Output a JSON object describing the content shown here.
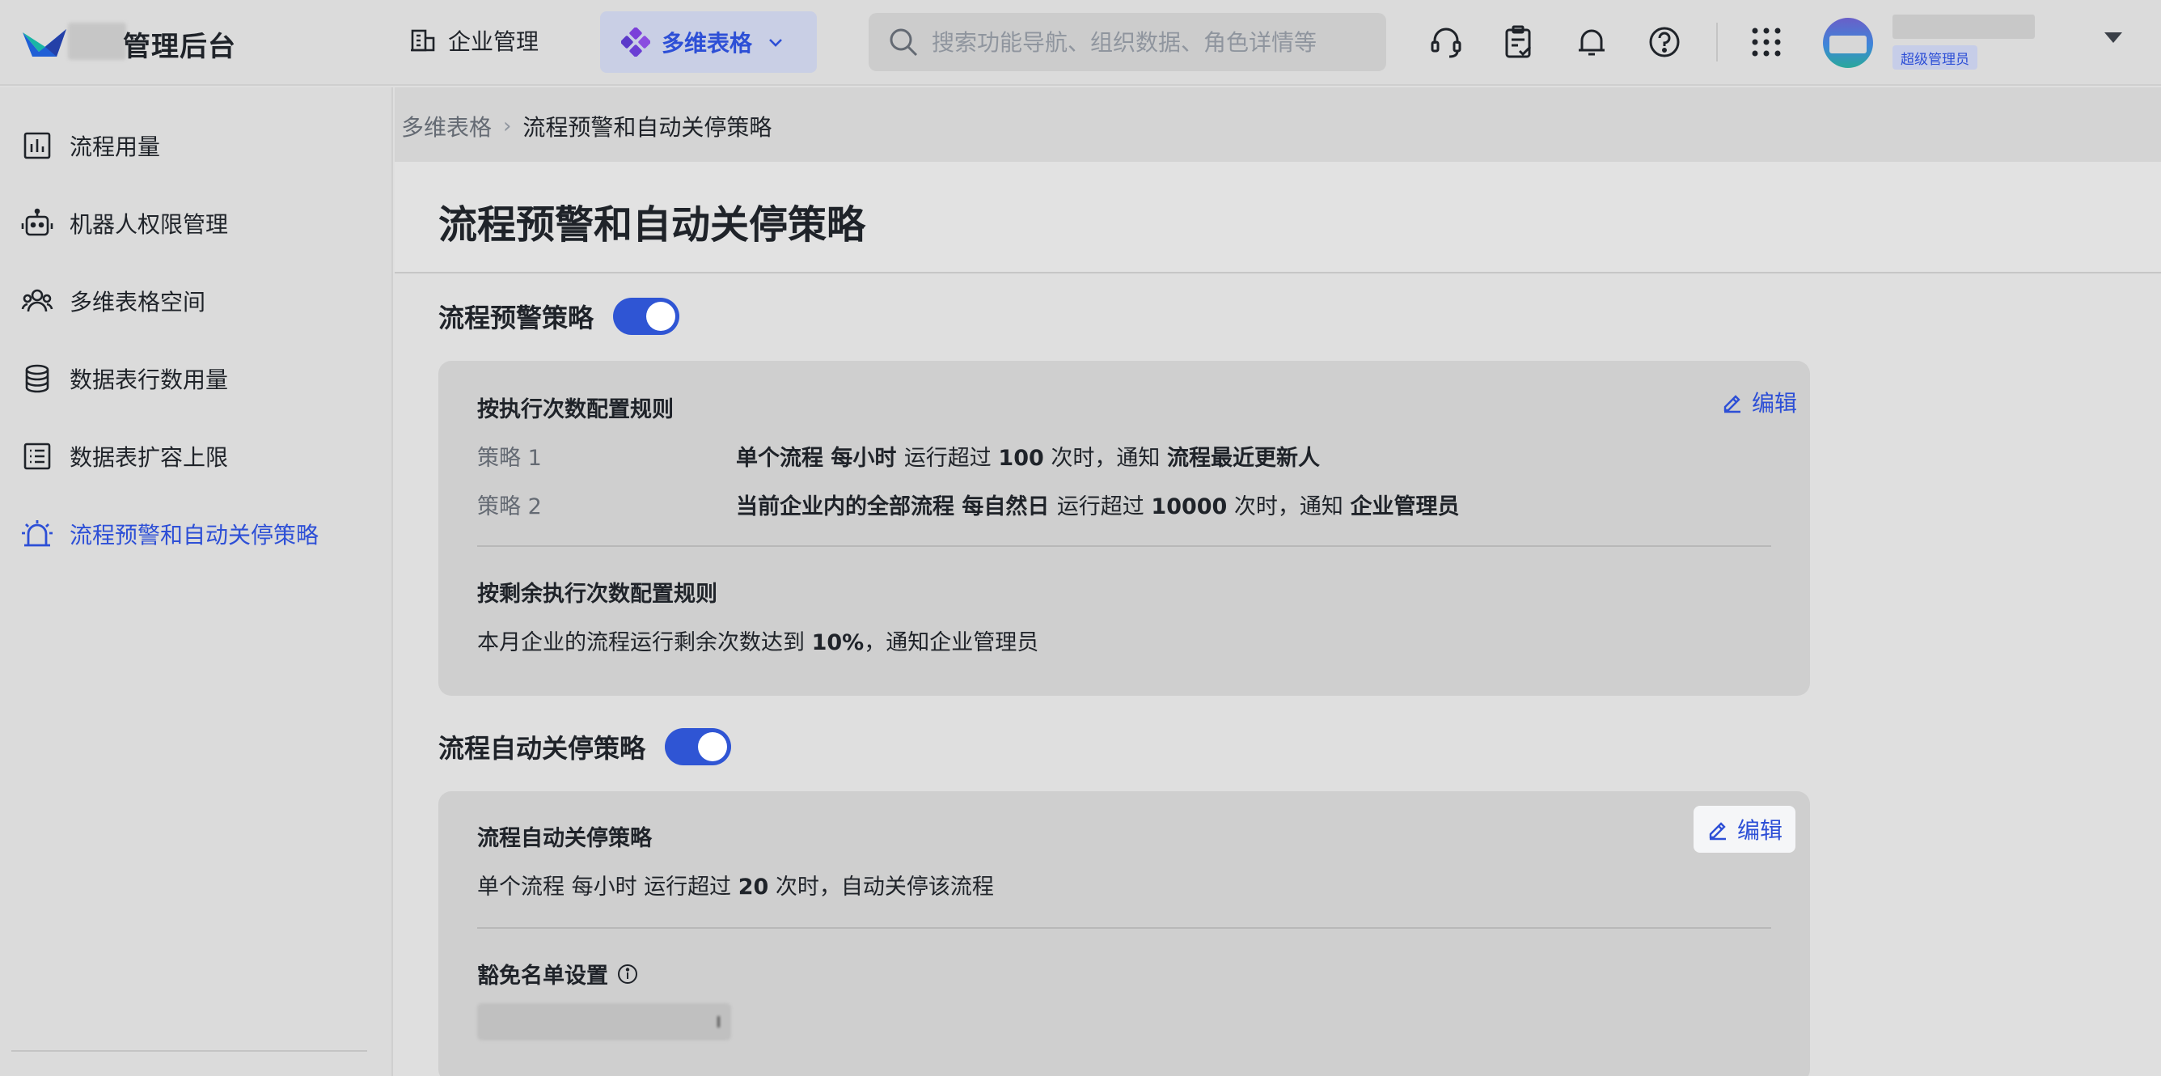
{
  "header": {
    "logo_text": "管理后台",
    "nav_org_label": "企业管理",
    "nav_bitable_label": "多维表格",
    "search_placeholder": "搜索功能导航、组织数据、角色详情等",
    "user_badge": "超级管理员",
    "icons": [
      "headset-icon",
      "clipboard-check-icon",
      "bell-icon",
      "help-icon",
      "apps-grid-icon"
    ],
    "accent_color": "#2d4fd6"
  },
  "sidebar": {
    "items": [
      {
        "label": "流程用量",
        "icon": "bar-chart-icon"
      },
      {
        "label": "机器人权限管理",
        "icon": "robot-icon"
      },
      {
        "label": "多维表格空间",
        "icon": "users-icon"
      },
      {
        "label": "数据表行数用量",
        "icon": "database-icon"
      },
      {
        "label": "数据表扩容上限",
        "icon": "list-icon"
      },
      {
        "label": "流程预警和自动关停策略",
        "icon": "alarm-icon",
        "active": true
      }
    ]
  },
  "breadcrumb": {
    "parent": "多维表格",
    "separator": "›",
    "current": "流程预警和自动关停策略"
  },
  "page": {
    "title": "流程预警和自动关停策略"
  },
  "warning_section": {
    "title": "流程预警策略",
    "enabled": true,
    "card": {
      "by_count_title": "按执行次数配置规则",
      "edit_label": "编辑",
      "rules": [
        {
          "label": "策略 1",
          "parts": [
            {
              "text": "单个流程",
              "bold": true
            },
            {
              "text": " 每小时 ",
              "bold": true
            },
            {
              "text": "运行超过 ",
              "bold": false
            },
            {
              "text": "100",
              "bold": true
            },
            {
              "text": " 次时，通知 ",
              "bold": false
            },
            {
              "text": "流程最近更新人",
              "bold": true
            }
          ]
        },
        {
          "label": "策略 2",
          "parts": [
            {
              "text": "当前企业内的全部流程",
              "bold": true
            },
            {
              "text": " 每自然日 ",
              "bold": true
            },
            {
              "text": "运行超过 ",
              "bold": false
            },
            {
              "text": "10000",
              "bold": true
            },
            {
              "text": " 次时，通知 ",
              "bold": false
            },
            {
              "text": "企业管理员",
              "bold": true
            }
          ]
        }
      ],
      "by_remaining_title": "按剩余执行次数配置规则",
      "remaining_text_before": "本月企业的流程运行剩余次数达到 ",
      "remaining_value": "10%",
      "remaining_text_after": "，通知企业管理员"
    }
  },
  "shutdown_section": {
    "title": "流程自动关停策略",
    "enabled": true,
    "card": {
      "subtitle": "流程自动关停策略",
      "edit_label": "编辑",
      "rule_before": "单个流程 每小时 运行超过 ",
      "rule_value": "20",
      "rule_after": " 次时，自动关停该流程",
      "exempt_title": "豁免名单设置"
    }
  }
}
